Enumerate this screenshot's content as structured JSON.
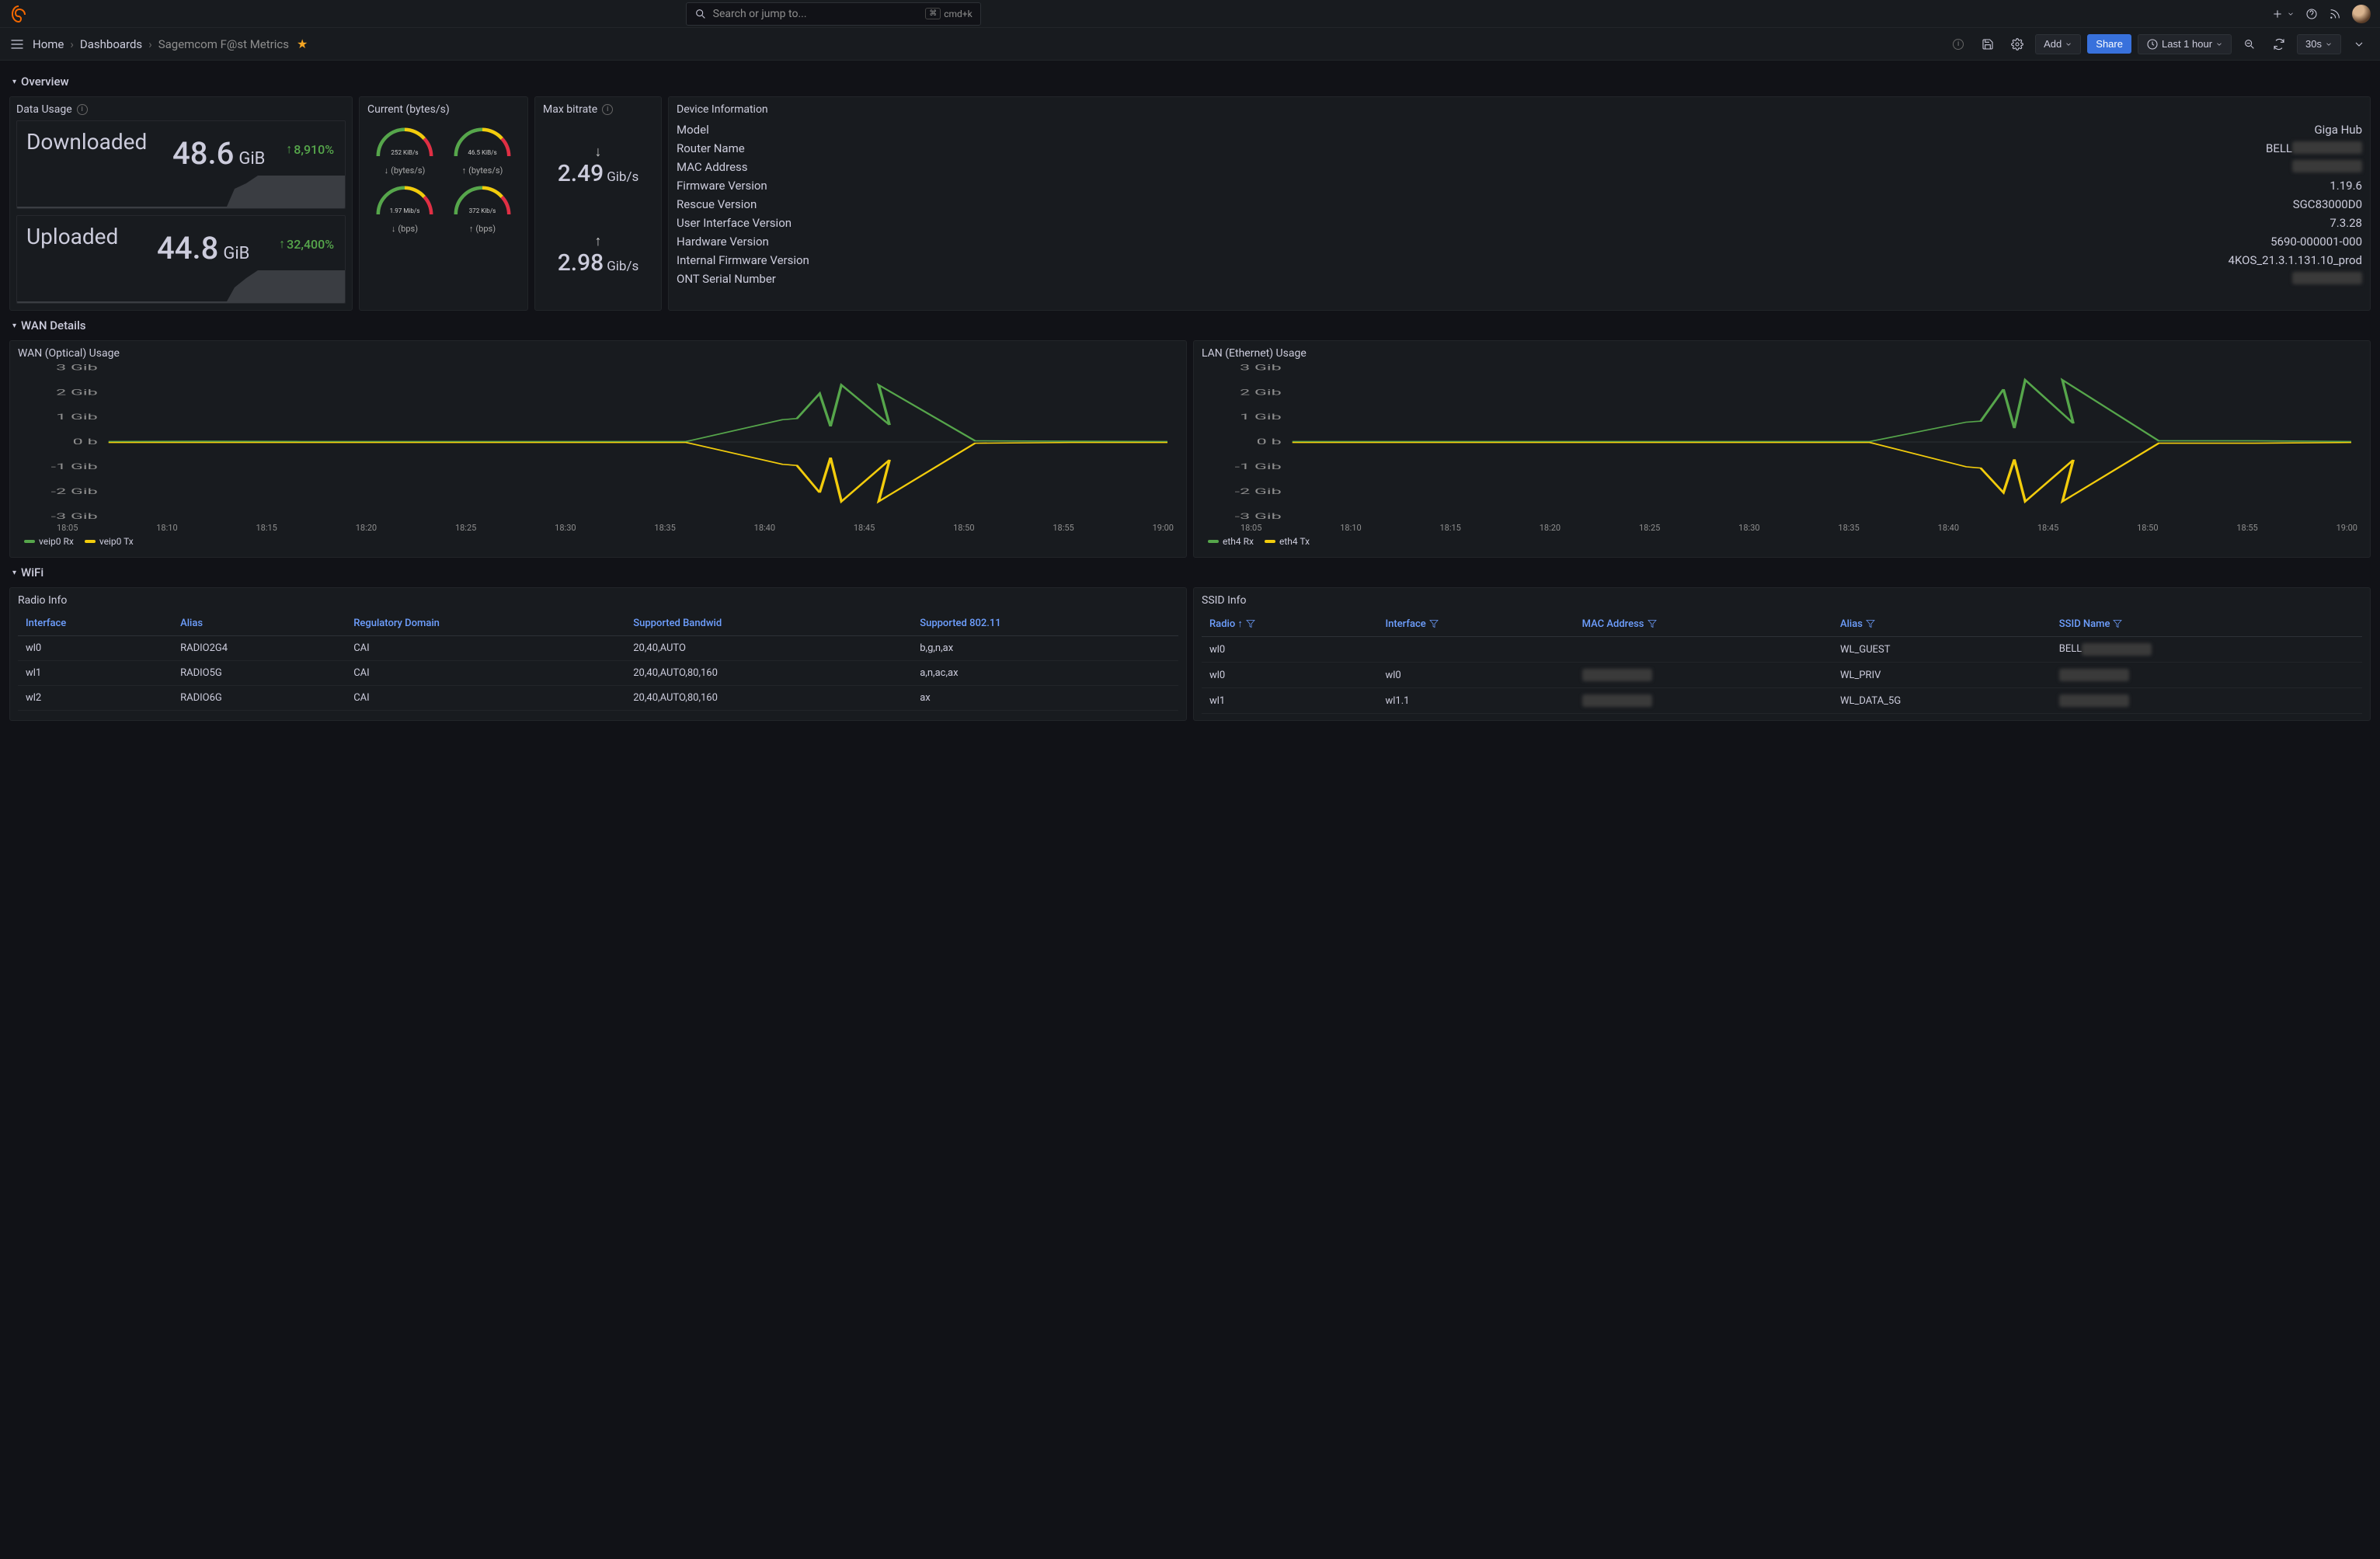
{
  "search": {
    "placeholder": "Search or jump to...",
    "shortcut": "cmd+k"
  },
  "breadcrumbs": {
    "home": "Home",
    "dashboards": "Dashboards",
    "current": "Sagemcom F@st Metrics"
  },
  "toolbar": {
    "add": "Add",
    "share": "Share",
    "timerange": "Last 1 hour",
    "refresh": "30s"
  },
  "sections": {
    "overview": "Overview",
    "wan": "WAN Details",
    "wifi": "WiFi"
  },
  "dataUsage": {
    "title": "Data Usage",
    "downloaded": {
      "label": "Downloaded",
      "value": "48.6",
      "unit": "GiB",
      "trend": "8,910%"
    },
    "uploaded": {
      "label": "Uploaded",
      "value": "44.8",
      "unit": "GiB",
      "trend": "32,400%"
    }
  },
  "current": {
    "title": "Current (bytes/s)",
    "gauges": [
      {
        "value": "252 KiB/s",
        "label": "(bytes/s)",
        "dir": "down"
      },
      {
        "value": "46.5 KiB/s",
        "label": "(bytes/s)",
        "dir": "up"
      },
      {
        "value": "1.97 Mib/s",
        "label": "(bps)",
        "dir": "down"
      },
      {
        "value": "372 Kib/s",
        "label": "(bps)",
        "dir": "up"
      }
    ]
  },
  "maxBitrate": {
    "title": "Max bitrate",
    "down": {
      "value": "2.49",
      "unit": "Gib/s"
    },
    "up": {
      "value": "2.98",
      "unit": "Gib/s"
    }
  },
  "devInfo": {
    "title": "Device Information",
    "rows": [
      {
        "k": "Model",
        "v": "Giga Hub"
      },
      {
        "k": "Router Name",
        "v": "BELL",
        "redact": true
      },
      {
        "k": "MAC Address",
        "v": "",
        "redact": true
      },
      {
        "k": "Firmware Version",
        "v": "1.19.6"
      },
      {
        "k": "Rescue Version",
        "v": "SGC83000D0"
      },
      {
        "k": "User Interface Version",
        "v": "7.3.28"
      },
      {
        "k": "Hardware Version",
        "v": "5690-000001-000"
      },
      {
        "k": "Internal Firmware Version",
        "v": "4KOS_21.3.1.131.10_prod"
      },
      {
        "k": "ONT Serial Number",
        "v": "",
        "redact": true
      }
    ]
  },
  "wanChart": {
    "title": "WAN (Optical) Usage",
    "yTicks": [
      "3 Gib",
      "2 Gib",
      "1 Gib",
      "0 b",
      "-1 Gib",
      "-2 Gib",
      "-3 Gib"
    ],
    "xTicks": [
      "18:05",
      "18:10",
      "18:15",
      "18:20",
      "18:25",
      "18:30",
      "18:35",
      "18:40",
      "18:45",
      "18:50",
      "18:55",
      "19:00"
    ],
    "legend": [
      {
        "name": "veip0 Rx",
        "color": "#56a64b"
      },
      {
        "name": "veip0 Tx",
        "color": "#f2cc0c"
      }
    ]
  },
  "lanChart": {
    "title": "LAN (Ethernet) Usage",
    "yTicks": [
      "3 Gib",
      "2 Gib",
      "1 Gib",
      "0 b",
      "-1 Gib",
      "-2 Gib",
      "-3 Gib"
    ],
    "xTicks": [
      "18:05",
      "18:10",
      "18:15",
      "18:20",
      "18:25",
      "18:30",
      "18:35",
      "18:40",
      "18:45",
      "18:50",
      "18:55",
      "19:00"
    ],
    "legend": [
      {
        "name": "eth4 Rx",
        "color": "#56a64b"
      },
      {
        "name": "eth4 Tx",
        "color": "#f2cc0c"
      }
    ]
  },
  "radioInfo": {
    "title": "Radio Info",
    "cols": [
      "Interface",
      "Alias",
      "Regulatory Domain",
      "Supported Bandwid",
      "Supported 802.11"
    ],
    "rows": [
      [
        "wl0",
        "RADIO2G4",
        "CAI",
        "20,40,AUTO",
        "b,g,n,ax"
      ],
      [
        "wl1",
        "RADIO5G",
        "CAI",
        "20,40,AUTO,80,160",
        "a,n,ac,ax"
      ],
      [
        "wl2",
        "RADIO6G",
        "CAI",
        "20,40,AUTO,80,160",
        "ax"
      ]
    ]
  },
  "ssidInfo": {
    "title": "SSID Info",
    "cols": [
      "Radio",
      "Interface",
      "MAC Address",
      "Alias",
      "SSID Name"
    ],
    "rows": [
      {
        "c": [
          "wl0",
          "",
          "",
          "WL_GUEST",
          "BELL"
        ],
        "redact": [
          4
        ],
        "redactPartial": [
          4
        ]
      },
      {
        "c": [
          "wl0",
          "wl0",
          "",
          "WL_PRIV",
          ""
        ],
        "redact": [
          2,
          4
        ]
      },
      {
        "c": [
          "wl1",
          "wl1.1",
          "",
          "WL_DATA_5G",
          ""
        ],
        "redact": [
          2,
          4
        ]
      }
    ]
  },
  "chart_data": [
    {
      "type": "line",
      "title": "WAN (Optical) Usage",
      "ylabel": "",
      "xlabel": "",
      "ylim": [
        -3,
        3
      ],
      "y_unit": "Gib",
      "x": [
        "18:05",
        "18:10",
        "18:15",
        "18:20",
        "18:25",
        "18:30",
        "18:35",
        "18:40",
        "18:45",
        "18:50",
        "18:55",
        "19:00"
      ],
      "series": [
        {
          "name": "veip0 Rx",
          "color": "#56a64b",
          "values": [
            0.02,
            0.03,
            0.02,
            0.02,
            0.02,
            0.02,
            0.02,
            0.9,
            2.3,
            0.05,
            0.03,
            0.02
          ]
        },
        {
          "name": "veip0 Tx",
          "color": "#f2cc0c",
          "values": [
            -0.02,
            -0.02,
            -0.02,
            -0.02,
            -0.02,
            -0.02,
            -0.02,
            -0.9,
            -2.4,
            -0.05,
            -0.02,
            -0.02
          ]
        }
      ]
    },
    {
      "type": "line",
      "title": "LAN (Ethernet) Usage",
      "ylabel": "",
      "xlabel": "",
      "ylim": [
        -3,
        3
      ],
      "y_unit": "Gib",
      "x": [
        "18:05",
        "18:10",
        "18:15",
        "18:20",
        "18:25",
        "18:30",
        "18:35",
        "18:40",
        "18:45",
        "18:50",
        "18:55",
        "19:00"
      ],
      "series": [
        {
          "name": "eth4 Rx",
          "color": "#56a64b",
          "values": [
            0.02,
            0.02,
            0.02,
            0.02,
            0.02,
            0.02,
            0.02,
            0.8,
            2.5,
            0.05,
            0.05,
            0.02
          ]
        },
        {
          "name": "eth4 Tx",
          "color": "#f2cc0c",
          "values": [
            -0.02,
            -0.02,
            -0.02,
            -0.02,
            -0.02,
            -0.02,
            -0.02,
            -1.0,
            -2.4,
            -0.05,
            -0.05,
            -0.02
          ]
        }
      ]
    }
  ]
}
